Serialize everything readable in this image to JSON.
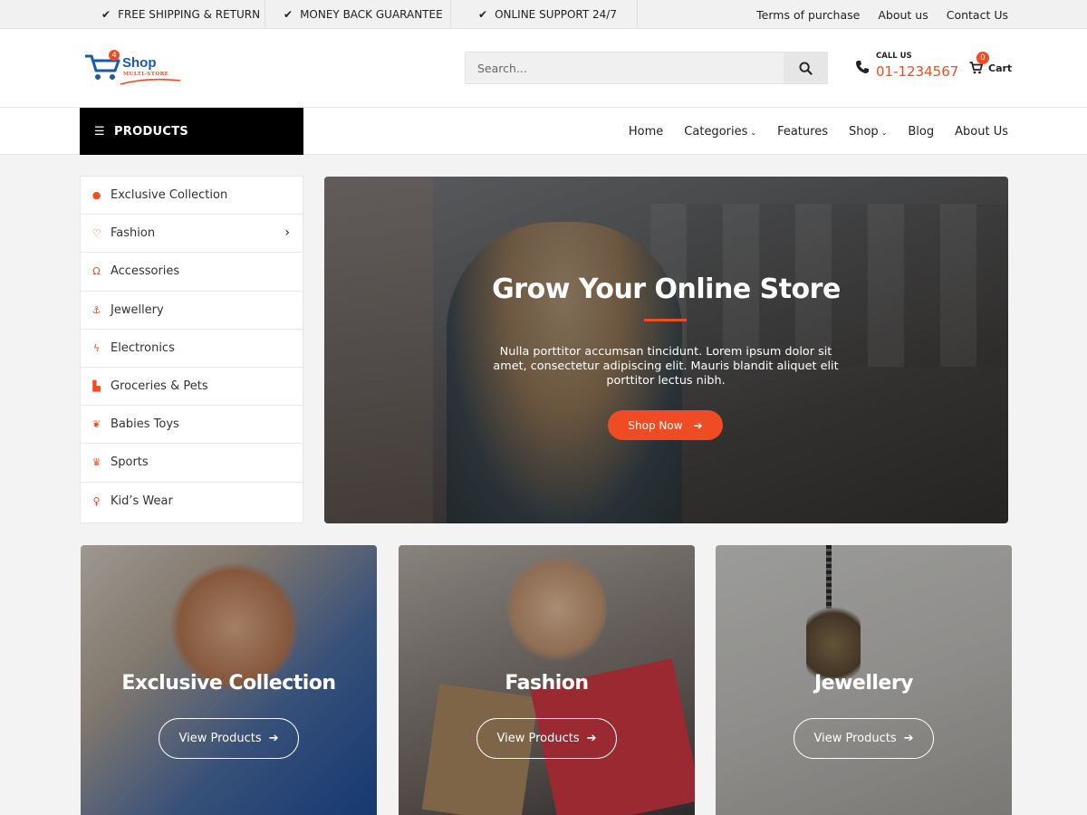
{
  "topbar": {
    "perks": [
      "FREE SHIPPING & RETURN",
      "MONEY BACK GUARANTEE",
      "ONLINE SUPPORT 24/7"
    ],
    "links": [
      "Terms of purchase",
      "About us",
      "Contact Us"
    ]
  },
  "header": {
    "logo": {
      "brand": "Shop",
      "sub": "MULTI-STORE",
      "badge": "4"
    },
    "search": {
      "placeholder": "Search..."
    },
    "call": {
      "label": "CALL US",
      "number": "01-1234567"
    },
    "cart": {
      "label": "Cart",
      "count": "0"
    }
  },
  "nav": {
    "products_label": "PRODUCTS",
    "items": [
      {
        "label": "Home"
      },
      {
        "label": "Categories"
      },
      {
        "label": "Features"
      },
      {
        "label": "Shop"
      },
      {
        "label": "Blog"
      },
      {
        "label": "About Us"
      }
    ]
  },
  "sidebar": {
    "items": [
      {
        "label": "Exclusive Collection",
        "icon": "info-circle-icon"
      },
      {
        "label": "Fashion",
        "icon": "heart-icon"
      },
      {
        "label": "Accessories",
        "icon": "headphones-icon"
      },
      {
        "label": "Jewellery",
        "icon": "anchor-icon"
      },
      {
        "label": "Electronics",
        "icon": "bolt-icon"
      },
      {
        "label": "Groceries & Pets",
        "icon": "bathtub-icon"
      },
      {
        "label": "Babies Toys",
        "icon": "medal-icon"
      },
      {
        "label": "Sports",
        "icon": "trophy-icon"
      },
      {
        "label": "Kid’s Wear",
        "icon": "child-icon"
      }
    ]
  },
  "hero": {
    "title": "Grow Your Online Store",
    "text": "Nulla porttitor accumsan tincidunt. Lorem ipsum dolor sit amet, consectetur adipiscing elit. Mauris blandit aliquet elit porttitor lectus nibh.",
    "button": "Shop Now"
  },
  "cards": [
    {
      "title": "Exclusive Collection",
      "button": "View Products"
    },
    {
      "title": "Fashion",
      "button": "View Products"
    },
    {
      "title": "Jewellery",
      "button": "View Products"
    }
  ],
  "colors": {
    "accent": "#f04c23",
    "brand_blue": "#1a5aa8",
    "dark": "#000000"
  }
}
